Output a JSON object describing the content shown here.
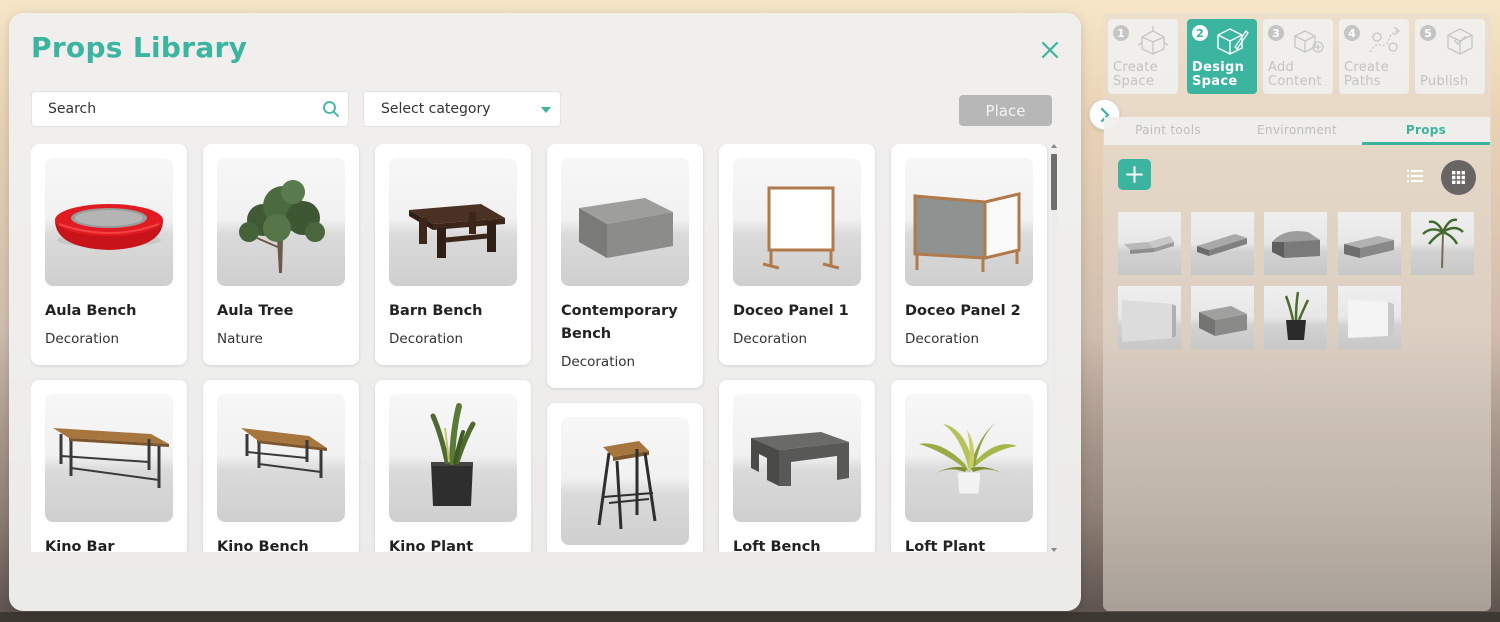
{
  "library": {
    "title": "Props Library",
    "search_placeholder": "Search",
    "category_label": "Select category",
    "place_label": "Place",
    "items": [
      {
        "name": "Aula Bench",
        "category": "Decoration",
        "icon": "aula-bench-icon"
      },
      {
        "name": "Aula Tree",
        "category": "Nature",
        "icon": "aula-tree-icon"
      },
      {
        "name": "Barn Bench",
        "category": "Decoration",
        "icon": "barn-bench-icon"
      },
      {
        "name": "Contemporary Bench",
        "category": "Decoration",
        "icon": "contemporary-bench-icon"
      },
      {
        "name": "Doceo Panel 1",
        "category": "Decoration",
        "icon": "doceo-panel-1-icon"
      },
      {
        "name": "Doceo Panel 2",
        "category": "Decoration",
        "icon": "doceo-panel-2-icon"
      },
      {
        "name": "Kino Bar",
        "category": "",
        "icon": "kino-bar-icon"
      },
      {
        "name": "Kino Bench",
        "category": "",
        "icon": "kino-bench-icon"
      },
      {
        "name": "Kino Plant",
        "category": "",
        "icon": "kino-plant-icon"
      },
      {
        "name": "",
        "category": "",
        "icon": "stool-icon"
      },
      {
        "name": "Loft Bench",
        "category": "",
        "icon": "loft-bench-icon"
      },
      {
        "name": "Loft Plant",
        "category": "",
        "icon": "loft-plant-icon"
      }
    ]
  },
  "steps": [
    {
      "num": "1",
      "label_line1": "Create",
      "label_line2": "Space",
      "icon": "cube-create-icon",
      "active": false
    },
    {
      "num": "2",
      "label_line1": "Design",
      "label_line2": "Space",
      "icon": "cube-design-icon",
      "active": true
    },
    {
      "num": "3",
      "label_line1": "Add",
      "label_line2": "Content",
      "icon": "add-content-icon",
      "active": false
    },
    {
      "num": "4",
      "label_line1": "Create",
      "label_line2": "Paths",
      "icon": "create-paths-icon",
      "active": false
    },
    {
      "num": "5",
      "label_line1": "Publish",
      "label_line2": "",
      "icon": "publish-icon",
      "active": false
    }
  ],
  "panel": {
    "tabs": [
      "Paint tools",
      "Environment",
      "Props"
    ],
    "active_tab": "Props",
    "placed_props": [
      "low-bench-thumb",
      "long-bench-thumb",
      "curved-seat-thumb",
      "bench-seat-thumb",
      "palm-tree-thumb",
      "wall-panel-thumb",
      "concrete-block-thumb",
      "potted-plant-thumb",
      "white-panel-thumb"
    ]
  },
  "colors": {
    "accent": "#3bb4a0",
    "place_disabled": "#b7b7b7",
    "grid_toggle": "#696564"
  }
}
